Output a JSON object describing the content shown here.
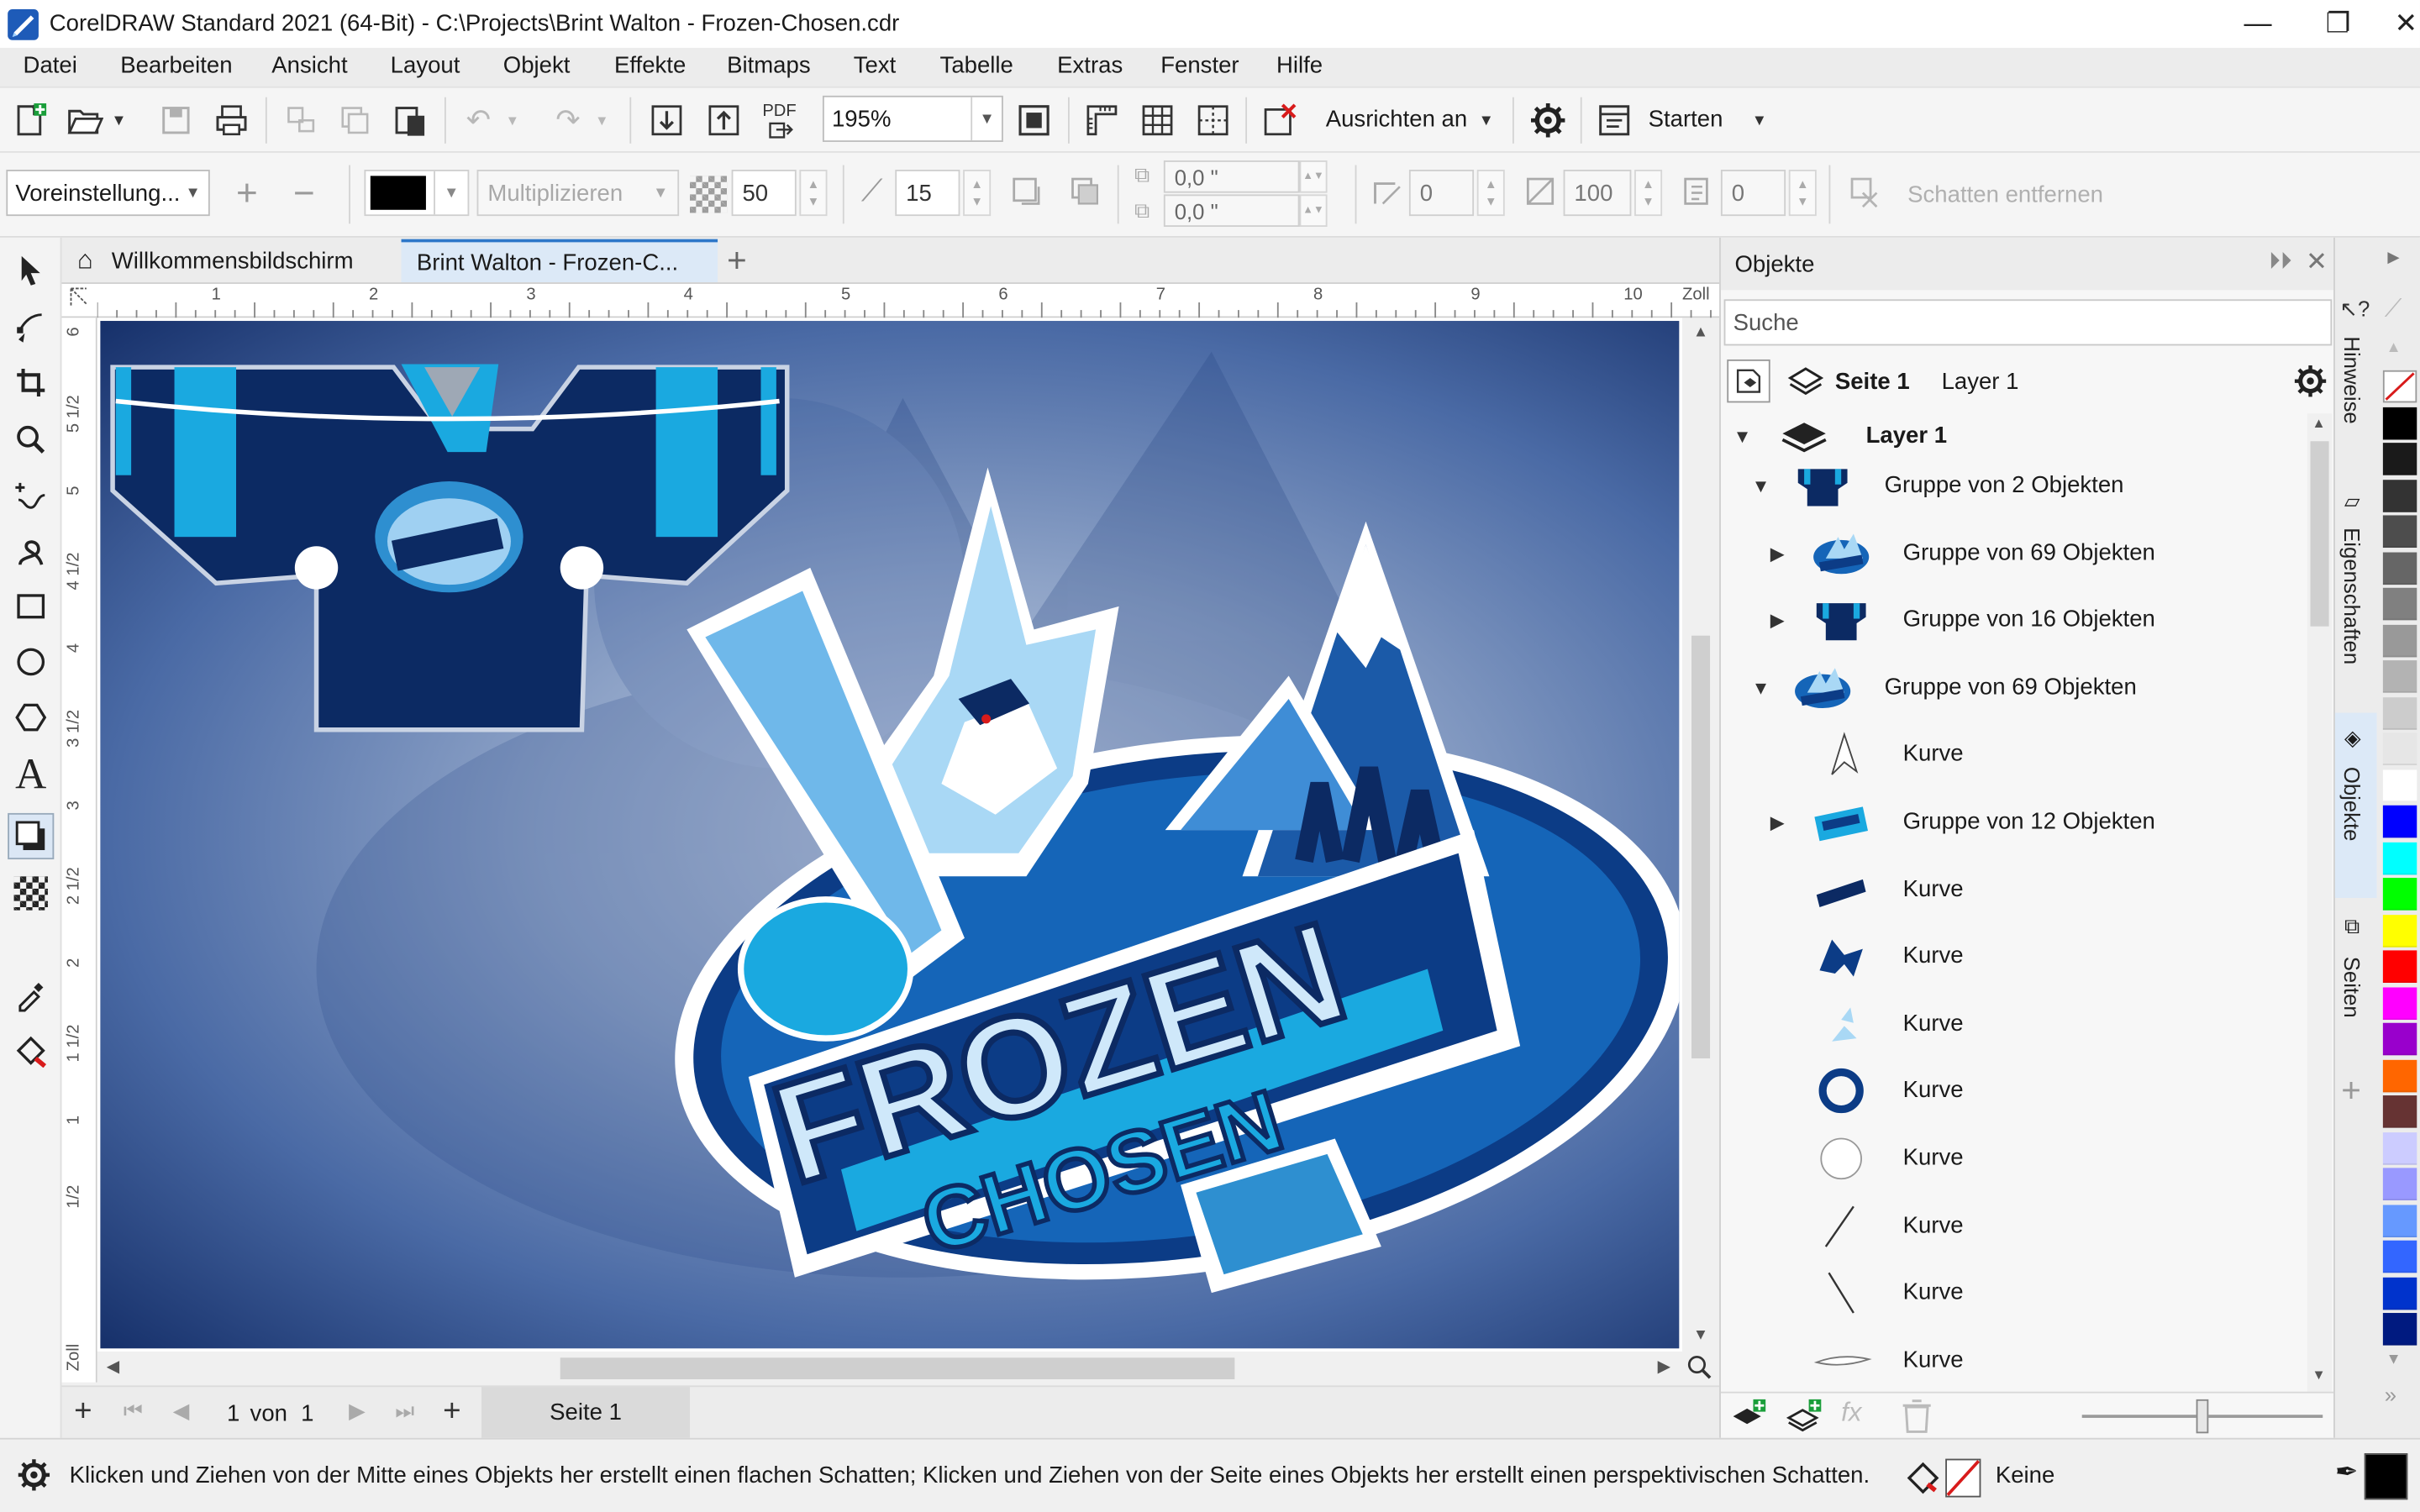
{
  "window": {
    "title": "CorelDRAW Standard 2021 (64-Bit) - C:\\Projects\\Brint Walton - Frozen-Chosen.cdr",
    "minimize": "—",
    "maximize": "❐",
    "close": "✕"
  },
  "menu": [
    "Datei",
    "Bearbeiten",
    "Ansicht",
    "Layout",
    "Objekt",
    "Effekte",
    "Bitmaps",
    "Text",
    "Tabelle",
    "Extras",
    "Fenster",
    "Hilfe"
  ],
  "toolbar": {
    "pdf_label": "PDF",
    "zoom": "195%",
    "snap_label": "Ausrichten an",
    "start_label": "Starten"
  },
  "propbar": {
    "preset": "Voreinstellung...",
    "blend_mode": "Multiplizieren",
    "opacity": "50",
    "feather": "15",
    "offset_x": "0,0 \"",
    "offset_y": "0,0 \"",
    "angle": "0",
    "fade": "100",
    "stretch": "0",
    "remove_shadow": "Schatten entfernen",
    "shadow_color": "#000000"
  },
  "tabs": {
    "welcome": "Willkommensbildschirm",
    "document": "Brint Walton - Frozen-C..."
  },
  "ruler": {
    "h_ticks": [
      "1",
      "2",
      "3",
      "4",
      "5",
      "6",
      "7",
      "8",
      "9",
      "10"
    ],
    "unit": "Zoll",
    "v_ticks": [
      "6",
      "5 1/2",
      "5",
      "4 1/2",
      "4",
      "3 1/2",
      "3",
      "2 1/2",
      "2",
      "1 1/2",
      "1",
      "1/2"
    ],
    "v_unit": "Zoll"
  },
  "artwork": {
    "line1": "FROZEN",
    "line2": "CHOSEN"
  },
  "pagenav": {
    "current": "1",
    "of_label": "von",
    "total": "1",
    "page_tab": "Seite 1"
  },
  "docker": {
    "title": "Objekte",
    "search_placeholder": "Suche",
    "page_label": "Seite 1",
    "layer_label": "Layer 1",
    "tree": [
      {
        "label": "Layer 1",
        "indent": 0,
        "arrow": "open",
        "kind": "layer"
      },
      {
        "label": "Gruppe von 2 Objekten",
        "indent": 1,
        "arrow": "open",
        "kind": "jersey"
      },
      {
        "label": "Gruppe von 69 Objekten",
        "indent": 2,
        "arrow": "closed",
        "kind": "logo"
      },
      {
        "label": "Gruppe von 16 Objekten",
        "indent": 2,
        "arrow": "closed",
        "kind": "jersey"
      },
      {
        "label": "Gruppe von 69 Objekten",
        "indent": 1,
        "arrow": "open",
        "kind": "logo"
      },
      {
        "label": "Kurve",
        "indent": 2,
        "arrow": "none",
        "kind": "spike"
      },
      {
        "label": "Gruppe von 12 Objekten",
        "indent": 2,
        "arrow": "closed",
        "kind": "text"
      },
      {
        "label": "Kurve",
        "indent": 2,
        "arrow": "none",
        "kind": "bar"
      },
      {
        "label": "Kurve",
        "indent": 2,
        "arrow": "none",
        "kind": "claw"
      },
      {
        "label": "Kurve",
        "indent": 2,
        "arrow": "none",
        "kind": "shards"
      },
      {
        "label": "Kurve",
        "indent": 2,
        "arrow": "none",
        "kind": "ring"
      },
      {
        "label": "Kurve",
        "indent": 2,
        "arrow": "none",
        "kind": "circle"
      },
      {
        "label": "Kurve",
        "indent": 2,
        "arrow": "none",
        "kind": "line1"
      },
      {
        "label": "Kurve",
        "indent": 2,
        "arrow": "none",
        "kind": "line2"
      },
      {
        "label": "Kurve",
        "indent": 2,
        "arrow": "none",
        "kind": "stroke"
      }
    ]
  },
  "side_tabs": [
    "Hinweise",
    "Eigenschaften",
    "Objekte",
    "Seiten"
  ],
  "palette": [
    "#ffffff",
    "#000000",
    "#1a1a1a",
    "#333333",
    "#4d4d4d",
    "#666666",
    "#808080",
    "#999999",
    "#b3b3b3",
    "#cccccc",
    "#e6e6e6",
    "#ffffff",
    "#0000ff",
    "#00ffff",
    "#00ff00",
    "#ffff00",
    "#ff0000",
    "#ff00ff",
    "#9900cc",
    "#ff6600",
    "#663333",
    "#ccccff",
    "#9999ff",
    "#6699ff",
    "#3366ff",
    "#0033cc",
    "#001a80"
  ],
  "status": {
    "hint": "Klicken und Ziehen von der Mitte eines Objekts her erstellt einen flachen Schatten; Klicken und Ziehen von der Seite eines Objekts her erstellt einen perspektivischen Schatten.",
    "fill_label": "Keine"
  }
}
